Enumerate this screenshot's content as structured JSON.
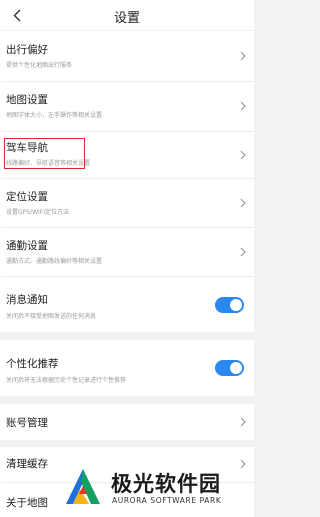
{
  "header": {
    "title": "设置",
    "back_icon": "chevron-left-icon"
  },
  "rows": {
    "travel_pref": {
      "title": "出行偏好",
      "subtitle": "提供个性化地图出行服务"
    },
    "map_settings": {
      "title": "地图设置",
      "subtitle": "地图字体大小，左手操作等相关设置"
    },
    "driving_nav": {
      "title": "驾车导航",
      "subtitle": "线路偏好、导航语音等相关设置"
    },
    "location": {
      "title": "定位设置",
      "subtitle": "设置GPS/WIFI定位方法"
    },
    "commute": {
      "title": "通勤设置",
      "subtitle": "通勤方式、通勤路线偏好等相关设置"
    },
    "notifications": {
      "title": "消息通知",
      "subtitle": "关闭后不接受地图发送的任何消息",
      "enabled": true
    },
    "personalized": {
      "title": "个性化推荐",
      "subtitle": "关闭后将无法根据历史个性记录进行个性推荐",
      "enabled": true
    },
    "account": {
      "title": "账号管理"
    },
    "cache": {
      "title": "清理缓存"
    },
    "about": {
      "title": "关于地图"
    }
  },
  "colors": {
    "accent": "#2b88ee",
    "highlight": "#e0262b",
    "background": "#f2f2f2"
  },
  "watermark": {
    "title": "极光软件园",
    "subtitle": "AURORA SOFTWARE PARK"
  }
}
